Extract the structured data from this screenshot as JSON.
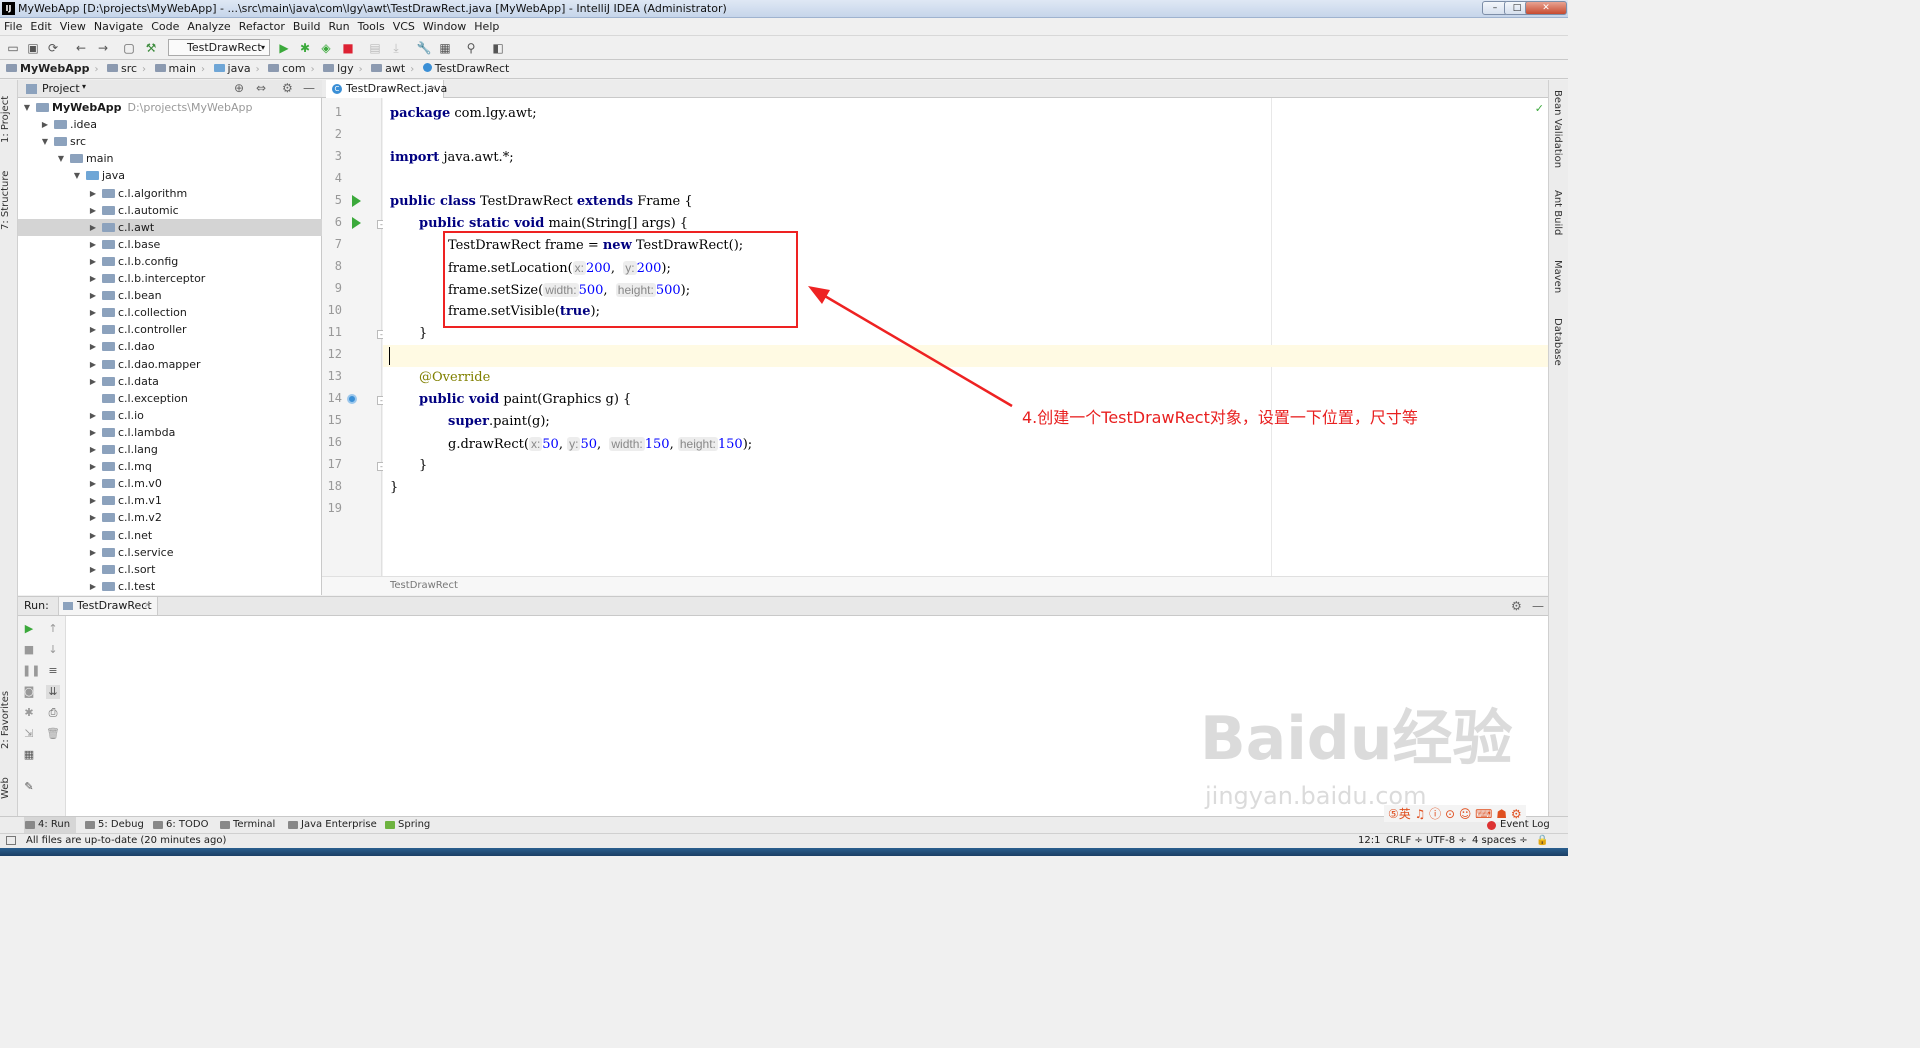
{
  "window": {
    "title": "MyWebApp [D:\\projects\\MyWebApp] - ...\\src\\main\\java\\com\\lgy\\awt\\TestDrawRect.java [MyWebApp] - IntelliJ IDEA (Administrator)",
    "app_icon": "IJ"
  },
  "menu": [
    "File",
    "Edit",
    "View",
    "Navigate",
    "Code",
    "Analyze",
    "Refactor",
    "Build",
    "Run",
    "Tools",
    "VCS",
    "Window",
    "Help"
  ],
  "toolbar": {
    "run_config": "TestDrawRect"
  },
  "breadcrumb": [
    "MyWebApp",
    "src",
    "main",
    "java",
    "com",
    "lgy",
    "awt",
    "TestDrawRect"
  ],
  "left_tabs": {
    "project": "1: Project",
    "structure": "7: Structure",
    "favorites": "2: Favorites",
    "web": "Web"
  },
  "right_tabs": [
    "Bean Validation",
    "Ant Build",
    "Maven",
    "Database"
  ],
  "project": {
    "header": "Project",
    "root": {
      "name": "MyWebApp",
      "path": "D:\\projects\\MyWebApp"
    },
    "items": [
      ".idea",
      "src",
      "main",
      "java",
      "c.l.algorithm",
      "c.l.automic",
      "c.l.awt",
      "c.l.base",
      "c.l.b.config",
      "c.l.b.interceptor",
      "c.l.bean",
      "c.l.collection",
      "c.l.controller",
      "c.l.dao",
      "c.l.dao.mapper",
      "c.l.data",
      "c.l.exception",
      "c.l.io",
      "c.l.lambda",
      "c.l.lang",
      "c.l.mq",
      "c.l.m.v0",
      "c.l.m.v1",
      "c.l.m.v2",
      "c.l.net",
      "c.l.service",
      "c.l.sort",
      "c.l.test"
    ]
  },
  "editor": {
    "tab": "TestDrawRect.java",
    "line_numbers": [
      "1",
      "2",
      "3",
      "4",
      "5",
      "6",
      "7",
      "8",
      "9",
      "10",
      "11",
      "12",
      "13",
      "14",
      "15",
      "16",
      "17",
      "18",
      "19"
    ],
    "footer": "TestDrawRect",
    "code": {
      "l1_kw": "package",
      "l1_rest": " com.lgy.awt;",
      "l3_kw": "import",
      "l3_rest": " java.awt.*;",
      "l5_kw1": "public class",
      "l5_name": " TestDrawRect ",
      "l5_kw2": "extends",
      "l5_rest": " Frame {",
      "l6_kw": "public static void",
      "l6_rest": " main(String[] args) {",
      "l7_a": "TestDrawRect frame = ",
      "l7_kw": "new",
      "l7_b": " TestDrawRect();",
      "l8_a": "frame.setLocation(",
      "l8_h1": "x:",
      "l8_v1": "200",
      "l8_sep": ",  ",
      "l8_h2": "y:",
      "l8_v2": "200",
      "l8_b": ");",
      "l9_a": "frame.setSize(",
      "l9_h1": "width:",
      "l9_v1": "500",
      "l9_sep": ",  ",
      "l9_h2": "height:",
      "l9_v2": "500",
      "l9_b": ");",
      "l10_a": "frame.setVisible(",
      "l10_kw": "true",
      "l10_b": ");",
      "l11": "}",
      "l13": "@Override",
      "l14_kw": "public void",
      "l14_rest": " paint(Graphics g) {",
      "l15_kw": "super",
      "l15_rest": ".paint(g);",
      "l16_a": "g.drawRect(",
      "l16_h1": "x:",
      "l16_v1": "50",
      "l16_s1": ", ",
      "l16_h2": "y:",
      "l16_v2": "50",
      "l16_s2": ",  ",
      "l16_h3": "width:",
      "l16_v3": "150",
      "l16_s3": ", ",
      "l16_h4": "height:",
      "l16_v4": "150",
      "l16_b": ");",
      "l17": "}",
      "l18": "}"
    }
  },
  "annotation": "4.创建一个TestDrawRect对象，设置一下位置，尺寸等",
  "run_panel": {
    "label": "Run:",
    "tab": "TestDrawRect"
  },
  "bottom_tabs": [
    "4: Run",
    "5: Debug",
    "6: TODO",
    "Terminal",
    "Java Enterprise",
    "Spring"
  ],
  "event_log": "Event Log",
  "status": {
    "message": "All files are up-to-date (20 minutes ago)",
    "position": "12:1",
    "line_sep": "CRLF ÷",
    "encoding": "UTF-8 ÷",
    "indent": "4 spaces ÷"
  },
  "watermark": {
    "brand": "Baidu经验",
    "url": "jingyan.baidu.com"
  },
  "colors": {
    "annotation_red": "#ee2222",
    "keyword": "#000080",
    "number": "#0000ff"
  }
}
